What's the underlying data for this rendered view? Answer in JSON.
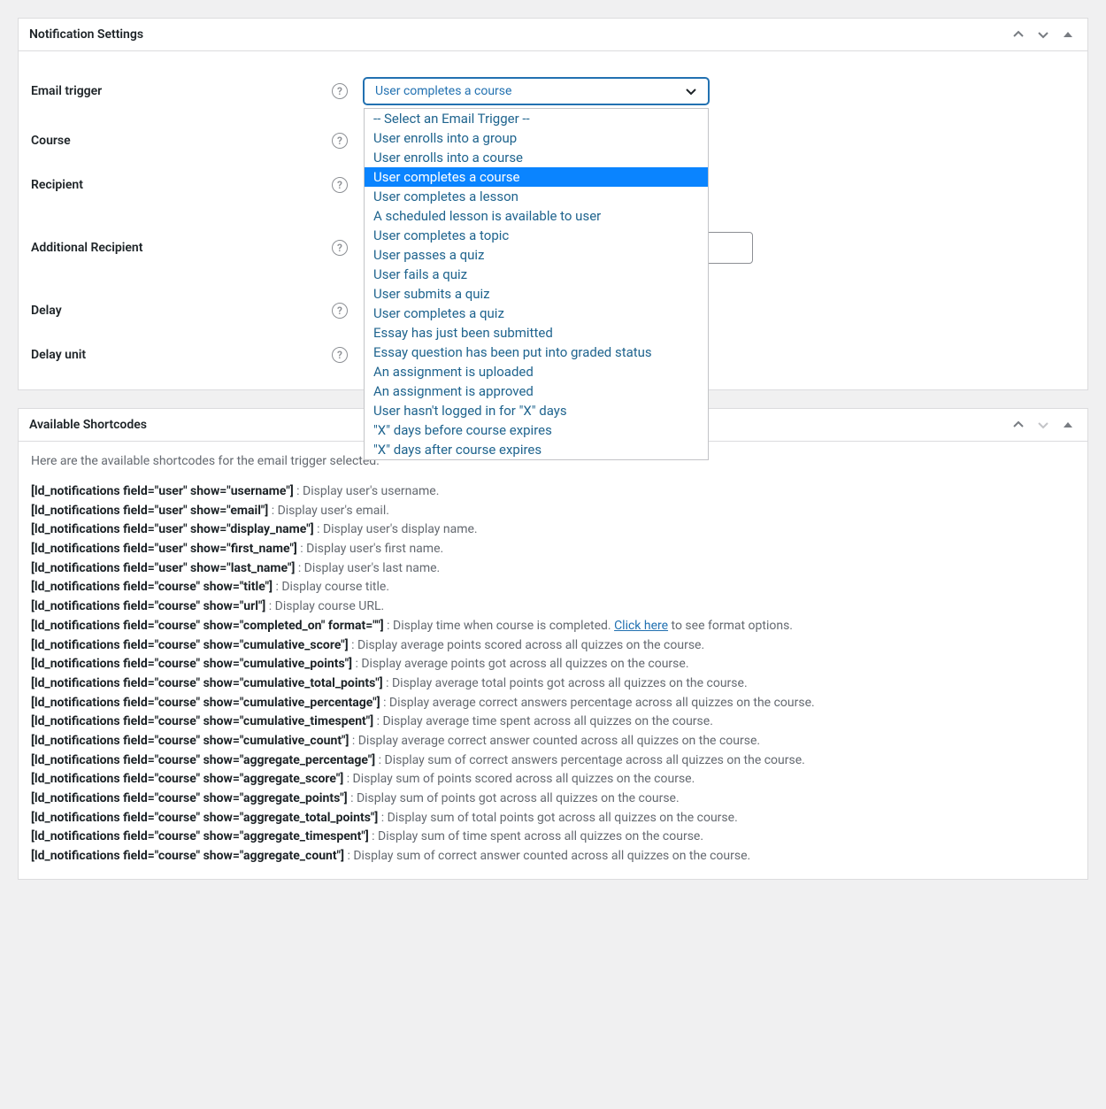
{
  "panels": {
    "settings": {
      "title": "Notification Settings",
      "fields": {
        "email_trigger": {
          "label": "Email trigger"
        },
        "course": {
          "label": "Course"
        },
        "recipient": {
          "label": "Recipient"
        },
        "additional_recipient": {
          "label": "Additional Recipient"
        },
        "delay": {
          "label": "Delay"
        },
        "delay_unit": {
          "label": "Delay unit"
        }
      },
      "trigger_select": {
        "selected": "User completes a course",
        "options": [
          "-- Select an Email Trigger --",
          "User enrolls into a group",
          "User enrolls into a course",
          "User completes a course",
          "User completes a lesson",
          "A scheduled lesson is available to user",
          "User completes a topic",
          "User passes a quiz",
          "User fails a quiz",
          "User submits a quiz",
          "User completes a quiz",
          "Essay has just been submitted",
          "Essay question has been put into graded status",
          "An assignment is uploaded",
          "An assignment is approved",
          "User hasn't logged in for \"X\" days",
          "\"X\" days before course expires",
          "\"X\" days after course expires"
        ]
      }
    },
    "shortcodes": {
      "title": "Available Shortcodes",
      "intro": "Here are the available shortcodes for the email trigger selected:",
      "link_text": "Click here",
      "items": [
        {
          "code": "[ld_notifications field=\"user\" show=\"username\"]",
          "desc": " : Display user's username."
        },
        {
          "code": "[ld_notifications field=\"user\" show=\"email\"]",
          "desc": " : Display user's email."
        },
        {
          "code": "[ld_notifications field=\"user\" show=\"display_name\"]",
          "desc": " : Display user's display name."
        },
        {
          "code": "[ld_notifications field=\"user\" show=\"first_name\"]",
          "desc": " : Display user's first name."
        },
        {
          "code": "[ld_notifications field=\"user\" show=\"last_name\"]",
          "desc": " : Display user's last name."
        },
        {
          "code": "[ld_notifications field=\"course\" show=\"title\"]",
          "desc": " : Display course title."
        },
        {
          "code": "[ld_notifications field=\"course\" show=\"url\"]",
          "desc": " : Display course URL."
        },
        {
          "code": "[ld_notifications field=\"course\" show=\"completed_on\" format=\"\"]",
          "desc": " : Display time when course is completed. ",
          "has_link": true,
          "after_link": " to see format options."
        },
        {
          "code": "[ld_notifications field=\"course\" show=\"cumulative_score\"]",
          "desc": " : Display average points scored across all quizzes on the course."
        },
        {
          "code": "[ld_notifications field=\"course\" show=\"cumulative_points\"]",
          "desc": " : Display average points got across all quizzes on the course."
        },
        {
          "code": "[ld_notifications field=\"course\" show=\"cumulative_total_points\"]",
          "desc": " : Display average total points got across all quizzes on the course."
        },
        {
          "code": "[ld_notifications field=\"course\" show=\"cumulative_percentage\"]",
          "desc": " : Display average correct answers percentage across all quizzes on the course."
        },
        {
          "code": "[ld_notifications field=\"course\" show=\"cumulative_timespent\"]",
          "desc": " : Display average time spent across all quizzes on the course."
        },
        {
          "code": "[ld_notifications field=\"course\" show=\"cumulative_count\"]",
          "desc": " : Display average correct answer counted across all quizzes on the course."
        },
        {
          "code": "[ld_notifications field=\"course\" show=\"aggregate_percentage\"]",
          "desc": " : Display sum of correct answers percentage across all quizzes on the course."
        },
        {
          "code": "[ld_notifications field=\"course\" show=\"aggregate_score\"]",
          "desc": " : Display sum of points scored across all quizzes on the course."
        },
        {
          "code": "[ld_notifications field=\"course\" show=\"aggregate_points\"]",
          "desc": " : Display sum of points got across all quizzes on the course."
        },
        {
          "code": "[ld_notifications field=\"course\" show=\"aggregate_total_points\"]",
          "desc": " : Display sum of total points got across all quizzes on the course."
        },
        {
          "code": "[ld_notifications field=\"course\" show=\"aggregate_timespent\"]",
          "desc": " : Display sum of time spent across all quizzes on the course."
        },
        {
          "code": "[ld_notifications field=\"course\" show=\"aggregate_count\"]",
          "desc": " : Display sum of correct answer counted across all quizzes on the course."
        }
      ]
    }
  }
}
